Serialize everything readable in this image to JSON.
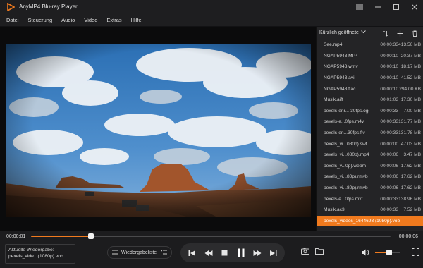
{
  "app": {
    "title": "AnyMP4 Blu-ray Player",
    "accent": "#f07a1e"
  },
  "menu": [
    "Datei",
    "Steuerung",
    "Audio",
    "Video",
    "Extras",
    "Hilfe"
  ],
  "playlist": {
    "header": "Kürzlich geöffnete",
    "items": [
      {
        "name": "See.mp4",
        "duration": "00:00:33",
        "size": "413.56 MB",
        "active": false
      },
      {
        "name": "NGAP5943.MP4",
        "duration": "00:00:10",
        "size": "20.37 MB",
        "active": false
      },
      {
        "name": "NGAP5943.wmv",
        "duration": "00:00:10",
        "size": "18.17 MB",
        "active": false
      },
      {
        "name": "NGAP5943.avi",
        "duration": "00:00:10",
        "size": "41.52 MB",
        "active": false
      },
      {
        "name": "NGAP5943.flac",
        "duration": "00:00:10",
        "size": "294.00 KB",
        "active": false
      },
      {
        "name": "Musik.aiff",
        "duration": "00:01:03",
        "size": "17.30 MB",
        "active": false
      },
      {
        "name": "pexels-enr...-30fps.ogg",
        "duration": "00:00:33",
        "size": "7.00 MB",
        "active": false
      },
      {
        "name": "pexels-e...0fps.m4v",
        "duration": "00:00:33",
        "size": "131.77 MB",
        "active": false
      },
      {
        "name": "pexels-en...30fps.flv",
        "duration": "00:00:33",
        "size": "131.78 MB",
        "active": false
      },
      {
        "name": "pexels_vi...080p).swf",
        "duration": "00:00:00",
        "size": "47.03 MB",
        "active": false
      },
      {
        "name": "pexels_vi...080p).mp4",
        "duration": "00:00:06",
        "size": "3.47 MB",
        "active": false
      },
      {
        "name": "pexels_v...0p).webm",
        "duration": "00:00:06",
        "size": "17.62 MB",
        "active": false
      },
      {
        "name": "pexels_vi...80p).rmvb",
        "duration": "00:00:06",
        "size": "17.62 MB",
        "active": false
      },
      {
        "name": "pexels_vi...80p).rmvb",
        "duration": "00:00:06",
        "size": "17.62 MB",
        "active": false
      },
      {
        "name": "pexels-e...0fps.mxf",
        "duration": "00:00:33",
        "size": "138.96 MB",
        "active": false
      },
      {
        "name": "Musik.ac3",
        "duration": "00:00:33",
        "size": "7.52 MB",
        "active": false
      },
      {
        "name": "pexels_videos_1644693 (1080p).vob",
        "duration": "",
        "size": "",
        "active": true
      }
    ]
  },
  "progress": {
    "current": "00:00:01",
    "total": "00:00:06",
    "fraction": 0.167
  },
  "now_playing": {
    "label": "Aktuelle Wiedergabe:",
    "file": "pexels_vide...(1080p).vob"
  },
  "playlist_button": {
    "label": "Wiedergabeliste"
  },
  "volume": {
    "fraction": 0.55
  }
}
